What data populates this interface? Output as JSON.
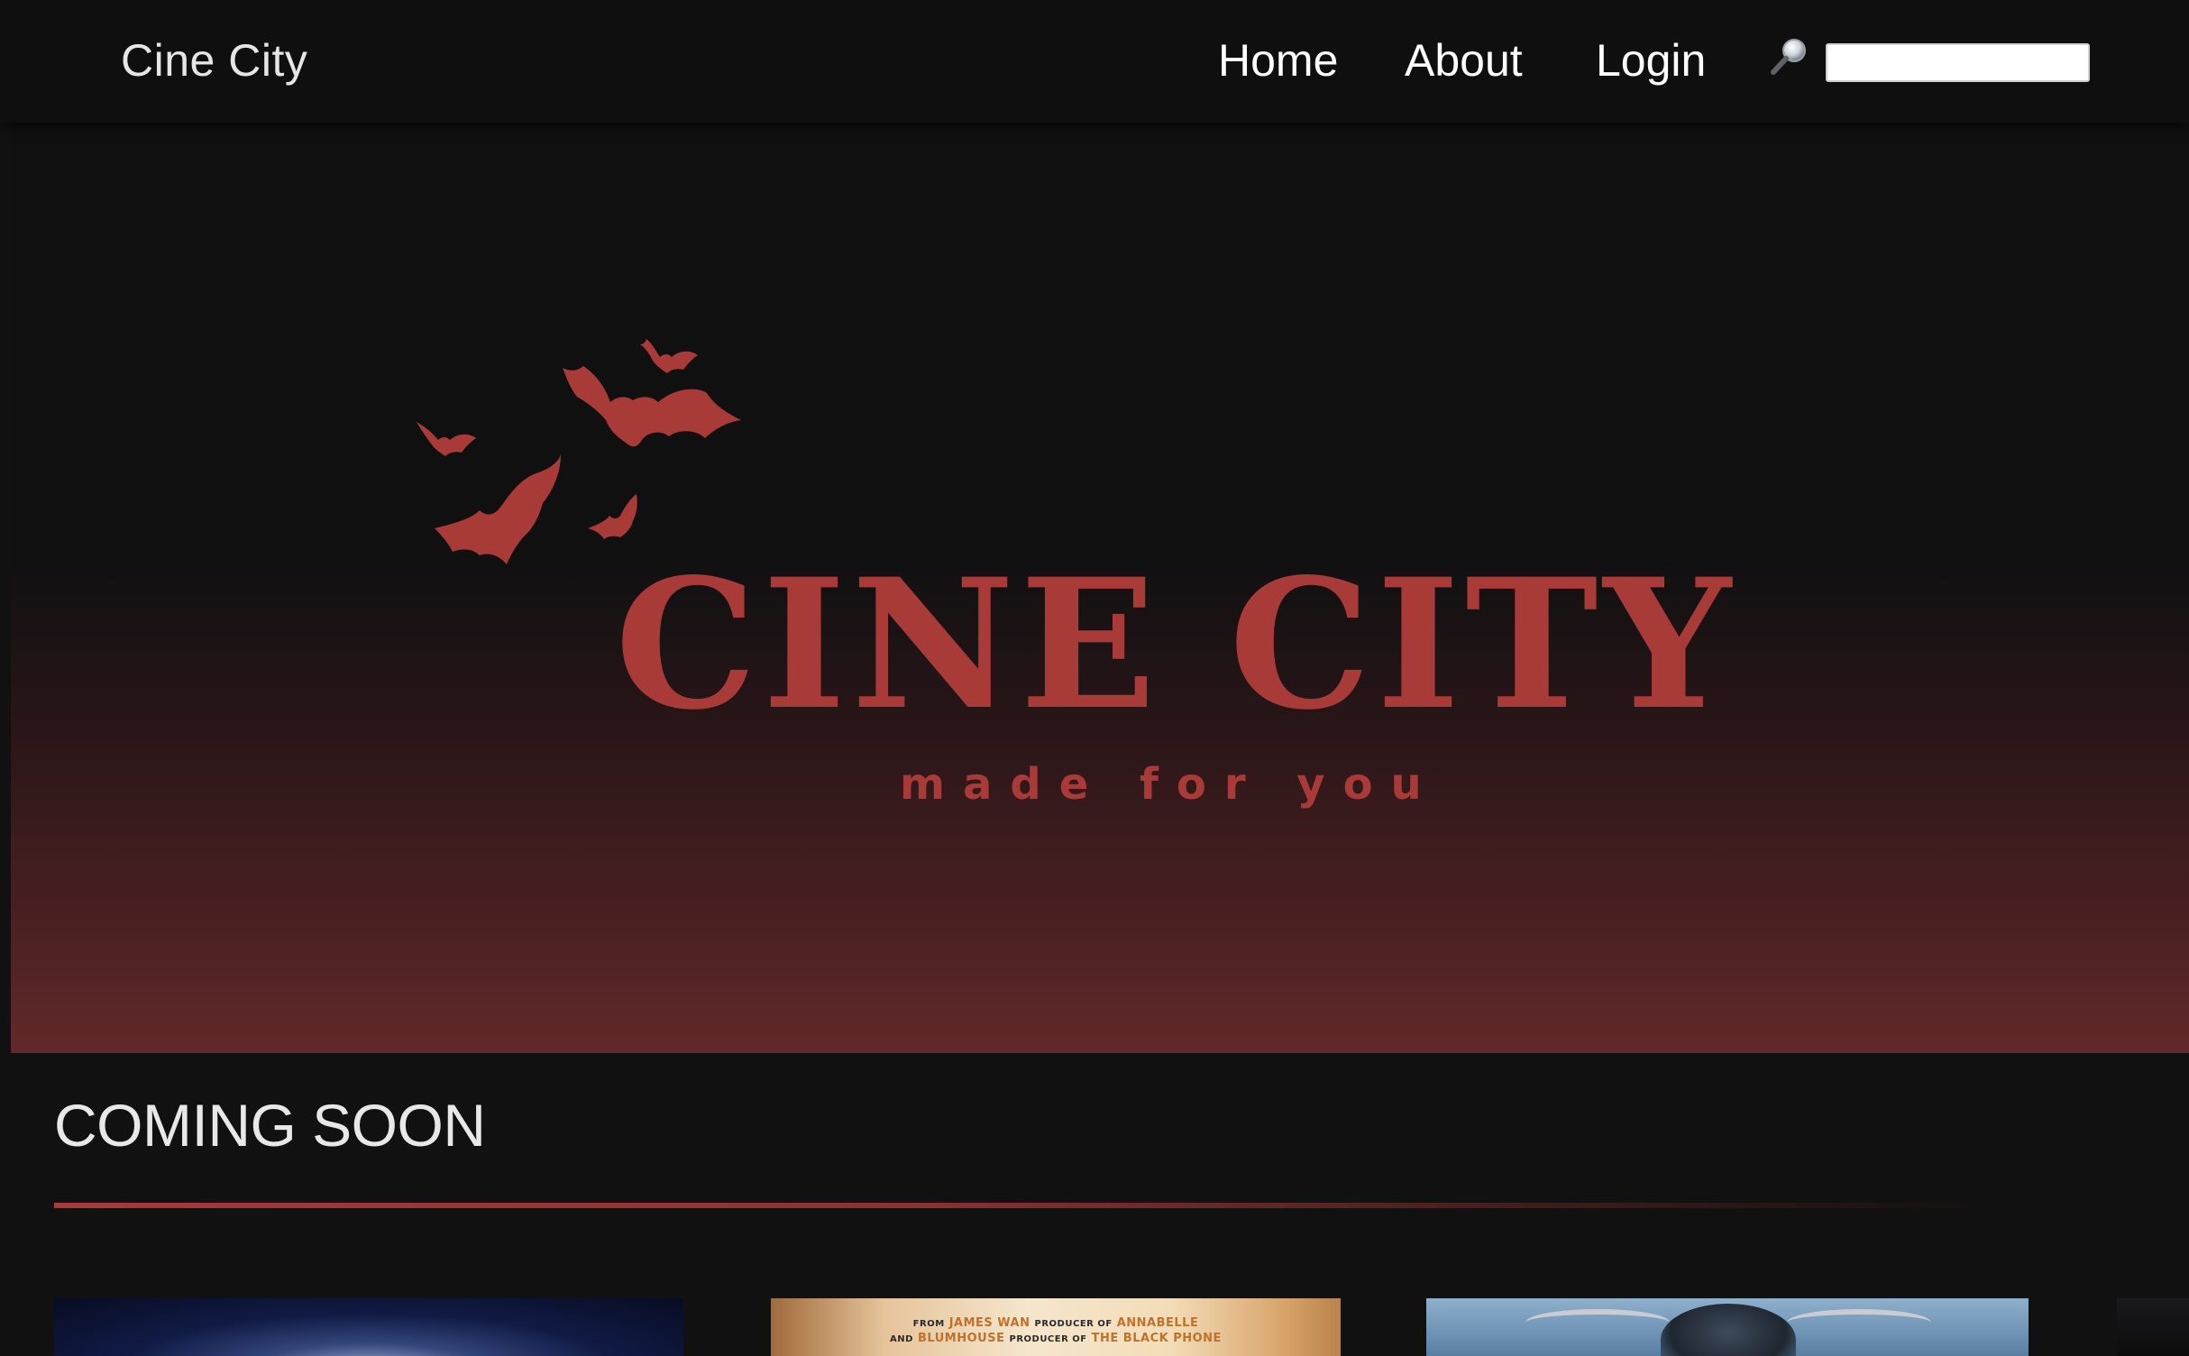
{
  "navbar": {
    "brand": "Cine City",
    "links": [
      {
        "label": "Home"
      },
      {
        "label": "About"
      },
      {
        "label": "Login"
      }
    ],
    "search": {
      "icon": "search-icon",
      "value": "",
      "placeholder": ""
    }
  },
  "hero": {
    "logo_title": "CINE CITY",
    "logo_tagline": "made for you",
    "logo_color": "#a83a37",
    "icon": "bats-icon"
  },
  "coming_soon": {
    "title": "COMING SOON",
    "accent_color": "#a83a37",
    "posters": [
      {
        "name": "poster-1"
      },
      {
        "name": "poster-2",
        "credit_line_1": {
          "from": "FROM",
          "name1": "JAMES WAN",
          "mid1": "PRODUCER OF",
          "title1": "ANNABELLE"
        },
        "credit_line_2": {
          "and": "AND",
          "name2": "BLUMHOUSE",
          "mid2": "PRODUCER OF",
          "title2": "THE BLACK PHONE"
        }
      },
      {
        "name": "poster-3"
      },
      {
        "name": "poster-4"
      }
    ]
  },
  "colors": {
    "background": "#111111",
    "navbar_bg": "#0f0f10",
    "text_primary": "#ffffff",
    "brand_red": "#a83a37"
  }
}
